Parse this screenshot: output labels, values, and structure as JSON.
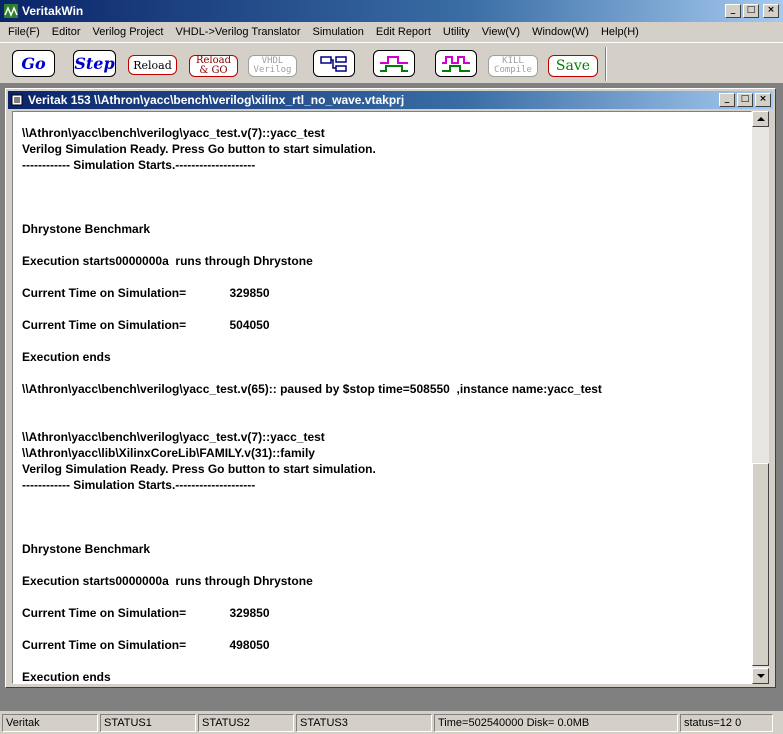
{
  "window": {
    "title": "VeritakWin"
  },
  "menu": [
    "File(F)",
    "Editor",
    "Verilog Project",
    "VHDL->Verilog Translator",
    "Simulation",
    "Edit Report",
    "Utility",
    "View(V)",
    "Window(W)",
    "Help(H)"
  ],
  "toolbar": {
    "go": "Go",
    "step": "Step",
    "reload": "Reload",
    "reload_go_1": "Reload",
    "reload_go_2": "& GO",
    "vhdl_1": "VHDL",
    "vhdl_2": "Verilog",
    "kill_1": "KILL",
    "kill_2": "Compile",
    "save": "Save"
  },
  "child": {
    "title": "Veritak 153 \\\\Athron\\yacc\\bench\\verilog\\xilinx_rtl_no_wave.vtakprj"
  },
  "console": {
    "lines": [
      "\\\\Athron\\yacc\\bench\\verilog\\yacc_test.v(7)::yacc_test",
      "Verilog Simulation Ready. Press Go button to start simulation.",
      "------------ Simulation Starts.--------------------",
      "",
      "",
      "",
      "Dhrystone Benchmark",
      "",
      "Execution starts0000000a  runs through Dhrystone",
      "",
      "Current Time on Simulation=             329850",
      "",
      "Current Time on Simulation=             504050",
      "",
      "Execution ends",
      "",
      "\\\\Athron\\yacc\\bench\\verilog\\yacc_test.v(65):: paused by $stop time=508550  ,instance name:yacc_test",
      "",
      "",
      "\\\\Athron\\yacc\\bench\\verilog\\yacc_test.v(7)::yacc_test",
      "\\\\Athron\\yacc\\lib\\XilinxCoreLib\\FAMILY.v(31)::family",
      "Verilog Simulation Ready. Press Go button to start simulation.",
      "------------ Simulation Starts.--------------------",
      "",
      "",
      "",
      "Dhrystone Benchmark",
      "",
      "Execution starts0000000a  runs through Dhrystone",
      "",
      "Current Time on Simulation=             329850",
      "",
      "Current Time on Simulation=             498050",
      "",
      "Execution ends"
    ]
  },
  "status": [
    "Veritak",
    "STATUS1",
    "STATUS2",
    "STATUS3",
    "Time=502540000 Disk=  0.0MB",
    "status=12 0"
  ],
  "icons": [
    "veritak-app-icon",
    "document-icon",
    "project-tree-icon",
    "waveform-icon",
    "waveform-multi-icon"
  ],
  "colors": {
    "title_start": "#0a246a",
    "title_end": "#a6caf0",
    "face": "#d4d0c8",
    "workspace": "#808080",
    "wave_magenta": "#d000d0",
    "wave_green": "#008000"
  }
}
